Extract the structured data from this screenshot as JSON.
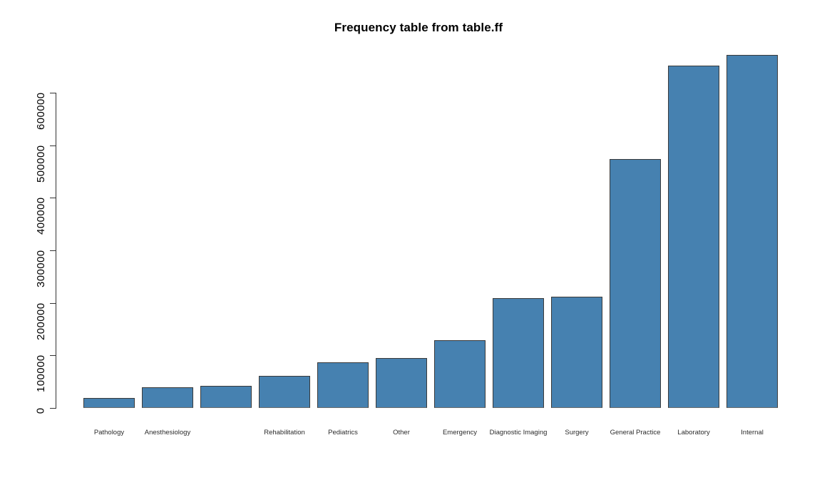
{
  "chart": {
    "title": "Frequency table from table.ff",
    "xlabel": "",
    "ylabel": ""
  },
  "axis": {
    "y_tick_labels": [
      "0",
      "100000",
      "200000",
      "300000",
      "400000",
      "500000",
      "600000"
    ]
  },
  "chart_data": {
    "type": "bar",
    "title": "Frequency table from table.ff",
    "xlabel": "",
    "ylabel": "",
    "ylim": [
      0,
      680000
    ],
    "yticks": [
      0,
      100000,
      200000,
      300000,
      400000,
      500000,
      600000
    ],
    "ytick_labels": [
      "0",
      "100000",
      "200000",
      "300000",
      "400000",
      "500000",
      "600000"
    ],
    "grid": false,
    "legend": false,
    "bar_color": "#4681b0",
    "bar_border_color": "#3a3a3a",
    "categories": [
      "Pathology",
      "Anesthesiology",
      "",
      "Rehabilitation",
      "Pediatrics",
      "Other",
      "Emergency",
      "Diagnostic Imaging",
      "Surgery",
      "General Practice",
      "Laboratory",
      "Internal"
    ],
    "tick_labels_shown": [
      "Pathology",
      "Anesthesiology",
      "",
      "Rehabilitation",
      "Pediatrics",
      "Other",
      "Emergency",
      "Diagnostic Imaging",
      "Surgery",
      "General Practice",
      "Laboratory",
      "Internal"
    ],
    "values": [
      19000,
      39000,
      42000,
      61000,
      87000,
      95000,
      129000,
      209000,
      212000,
      474000,
      652000,
      672000
    ]
  }
}
